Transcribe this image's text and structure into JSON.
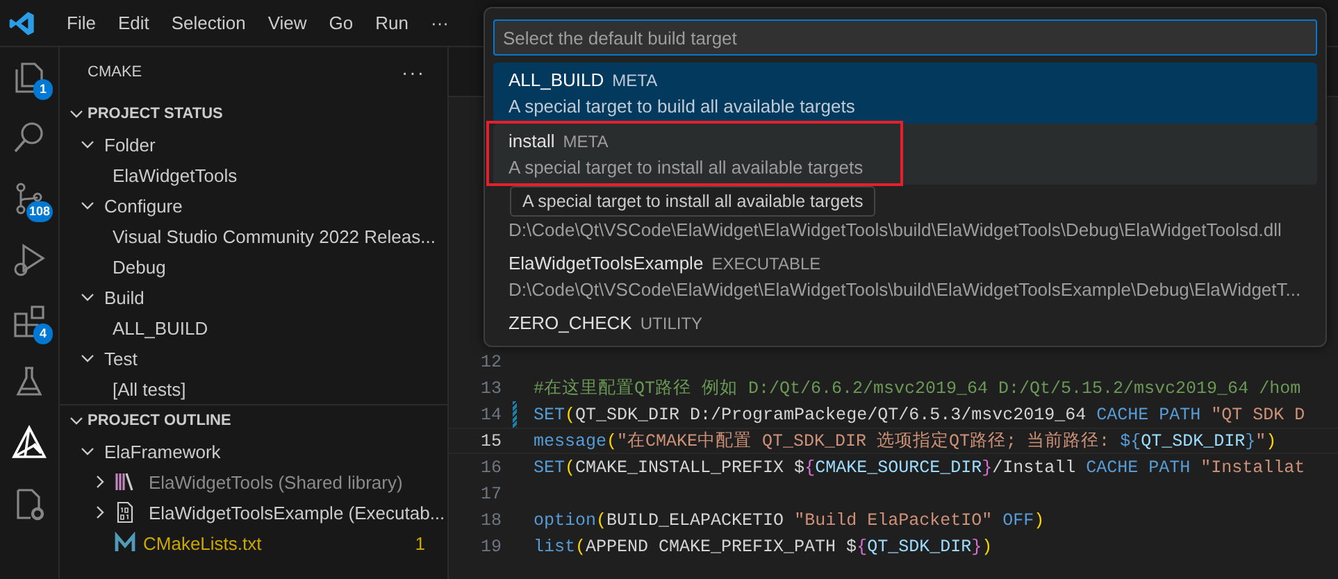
{
  "menu": [
    "File",
    "Edit",
    "Selection",
    "View",
    "Go",
    "Run",
    "···"
  ],
  "activity_bar": [
    {
      "kind": "files",
      "badge": "1",
      "selected": false
    },
    {
      "kind": "search",
      "selected": false
    },
    {
      "kind": "source-control",
      "badge": "108",
      "selected": false
    },
    {
      "kind": "debug",
      "selected": false
    },
    {
      "kind": "extensions",
      "badge": "4",
      "selected": false
    },
    {
      "kind": "testing",
      "selected": false
    },
    {
      "kind": "cmake",
      "selected": true
    },
    {
      "kind": "file-gear",
      "selected": false
    }
  ],
  "sidebar": {
    "title": "CMAKE",
    "more": "···",
    "sections": [
      {
        "title": "PROJECT STATUS",
        "expanded": true,
        "items": [
          {
            "label": "Folder",
            "expanded": true,
            "children": [
              {
                "label": "ElaWidgetTools"
              }
            ]
          },
          {
            "label": "Configure",
            "expanded": true,
            "children": [
              {
                "label": "Visual Studio Community 2022 Releas..."
              },
              {
                "label": "Debug"
              }
            ]
          },
          {
            "label": "Build",
            "expanded": true,
            "children": [
              {
                "label": "ALL_BUILD"
              }
            ]
          },
          {
            "label": "Test",
            "expanded": true,
            "children": [
              {
                "label": "[All tests]"
              }
            ]
          }
        ]
      },
      {
        "title": "PROJECT OUTLINE",
        "expanded": true,
        "items": [
          {
            "label": "ElaFramework",
            "expanded": true,
            "children": [
              {
                "label": "ElaWidgetTools (Shared library)",
                "kind": "library",
                "expanded": false,
                "dimmed": true
              },
              {
                "label": "ElaWidgetToolsExample (Executab...",
                "kind": "executable",
                "expanded": false,
                "dimmed": false
              },
              {
                "label": "CMakeLists.txt",
                "kind": "cmake",
                "modified": true,
                "badge": "1"
              }
            ]
          }
        ]
      }
    ]
  },
  "editor": {
    "lines": [
      {
        "number": "12",
        "current": false,
        "modified": false
      },
      {
        "number": "13",
        "current": false,
        "modified": false,
        "tokens": [
          {
            "kind": "comment",
            "text": "#在这里配置QT路径 例如 D:/Qt/6.6.2/msvc2019_64 D:/Qt/5.15.2/msvc2019_64 /hom"
          }
        ]
      },
      {
        "number": "14",
        "current": false,
        "modified": true,
        "tokens": [
          {
            "kind": "keyword",
            "text": "SET"
          },
          {
            "kind": "paren",
            "text": "("
          },
          {
            "kind": "plain",
            "text": "QT_SDK_DIR D:/ProgramPackege/QT/6.5.3/msvc2019_64 "
          },
          {
            "kind": "keyword",
            "text": "CACHE PATH "
          },
          {
            "kind": "string",
            "text": "\"QT SDK D"
          }
        ]
      },
      {
        "number": "15",
        "current": true,
        "modified": false,
        "tokens": [
          {
            "kind": "keyword",
            "text": "message"
          },
          {
            "kind": "paren",
            "text": "("
          },
          {
            "kind": "string",
            "text": "\"在CMAKE中配置 QT_SDK_DIR 选项指定QT路径; 当前路径: "
          },
          {
            "kind": "keyword",
            "text": "${"
          },
          {
            "kind": "variable",
            "text": "QT_SDK_DIR"
          },
          {
            "kind": "keyword",
            "text": "}"
          },
          {
            "kind": "string",
            "text": "\""
          },
          {
            "kind": "paren",
            "text": ")"
          }
        ]
      },
      {
        "number": "16",
        "current": false,
        "modified": false,
        "tokens": [
          {
            "kind": "keyword",
            "text": "SET"
          },
          {
            "kind": "paren",
            "text": "("
          },
          {
            "kind": "plain",
            "text": "CMAKE_INSTALL_PREFIX $"
          },
          {
            "kind": "brace",
            "text": "{"
          },
          {
            "kind": "variable",
            "text": "CMAKE_SOURCE_DIR"
          },
          {
            "kind": "brace",
            "text": "}"
          },
          {
            "kind": "plain",
            "text": "/Install "
          },
          {
            "kind": "keyword",
            "text": "CACHE PATH "
          },
          {
            "kind": "string",
            "text": "\"Installat"
          }
        ]
      },
      {
        "number": "17",
        "current": false,
        "modified": false
      },
      {
        "number": "18",
        "current": false,
        "modified": false,
        "tokens": [
          {
            "kind": "keyword",
            "text": "option"
          },
          {
            "kind": "paren",
            "text": "("
          },
          {
            "kind": "plain",
            "text": "BUILD_ELAPACKETIO "
          },
          {
            "kind": "string",
            "text": "\"Build ElaPacketIO\" "
          },
          {
            "kind": "keyword",
            "text": "OFF"
          },
          {
            "kind": "paren",
            "text": ")"
          }
        ]
      },
      {
        "number": "19",
        "current": false,
        "modified": false,
        "tokens": [
          {
            "kind": "keyword",
            "text": "list"
          },
          {
            "kind": "paren",
            "text": "("
          },
          {
            "kind": "plain",
            "text": "APPEND CMAKE_PREFIX_PATH $"
          },
          {
            "kind": "brace",
            "text": "{"
          },
          {
            "kind": "variable",
            "text": "QT_SDK_DIR"
          },
          {
            "kind": "brace",
            "text": "}"
          },
          {
            "kind": "paren",
            "text": ")"
          }
        ]
      }
    ]
  },
  "quick_pick": {
    "placeholder": "Select the default build target",
    "items": [
      {
        "name": "ALL_BUILD",
        "type": "META",
        "detail": "A special target to build all available targets",
        "selected": true,
        "annotated": false
      },
      {
        "name": "install",
        "type": "META",
        "detail": "A special target to install all available targets",
        "selected": false,
        "annotated": true,
        "tooltip": "A special target to install all available targets"
      },
      {
        "detail": "D:\\Code\\Qt\\VSCode\\ElaWidget\\ElaWidgetTools\\build\\ElaWidgetTools\\Debug\\ElaWidgetToolsd.dll",
        "selected": false,
        "annotated": false
      },
      {
        "name": "ElaWidgetToolsExample",
        "type": "EXECUTABLE",
        "detail": "D:\\Code\\Qt\\VSCode\\ElaWidget\\ElaWidgetTools\\build\\ElaWidgetToolsExample\\Debug\\ElaWidgetT...",
        "selected": false,
        "annotated": false
      },
      {
        "name": "ZERO_CHECK",
        "type": "UTILITY",
        "selected": false,
        "annotated": false
      }
    ]
  }
}
